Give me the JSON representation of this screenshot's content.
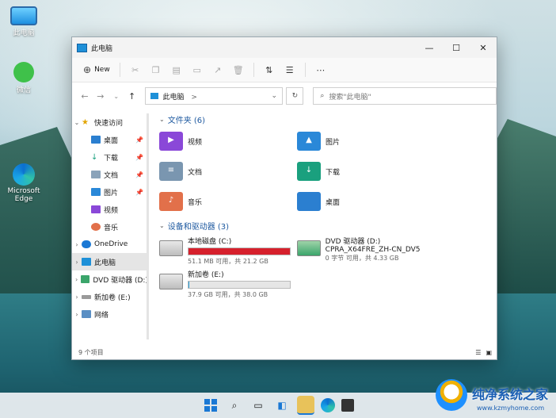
{
  "desktop": {
    "icons": [
      {
        "label": "此电脑",
        "icon": "computer-icon"
      },
      {
        "label": "微信",
        "icon": "wechat-icon"
      },
      {
        "label": "Microsoft Edge",
        "icon": "edge-icon"
      }
    ]
  },
  "window": {
    "title": "此电脑",
    "controls": {
      "minimize": "—",
      "maximize": "☐",
      "close": "✕"
    }
  },
  "toolbar": {
    "new_label": "New",
    "more_label": "⋯"
  },
  "address": {
    "path": "此电脑",
    "path_sep": ">",
    "search_placeholder": "搜索\"此电脑\""
  },
  "sidebar": {
    "items": [
      {
        "label": "快速访问",
        "level": 0,
        "expanded": true
      },
      {
        "label": "桌面",
        "level": 1,
        "pinned": true
      },
      {
        "label": "下载",
        "level": 1,
        "pinned": true
      },
      {
        "label": "文档",
        "level": 1,
        "pinned": true
      },
      {
        "label": "图片",
        "level": 1,
        "pinned": true
      },
      {
        "label": "视频",
        "level": 1,
        "pinned": false
      },
      {
        "label": "音乐",
        "level": 1,
        "pinned": false
      },
      {
        "label": "OneDrive",
        "level": 0
      },
      {
        "label": "此电脑",
        "level": 0,
        "selected": true
      },
      {
        "label": "DVD 驱动器 (D:)",
        "level": 0
      },
      {
        "label": "新加卷 (E:)",
        "level": 0
      },
      {
        "label": "网络",
        "level": 0
      }
    ]
  },
  "content": {
    "folders_header": "文件夹 (6)",
    "folders": [
      {
        "label": "视频",
        "color": "#8a48d8"
      },
      {
        "label": "图片",
        "color": "#2a88d8"
      },
      {
        "label": "文档",
        "color": "#7a96b0"
      },
      {
        "label": "下载",
        "color": "#1aa07e"
      },
      {
        "label": "音乐",
        "color": "#e2704a"
      },
      {
        "label": "桌面",
        "color": "#2b7fd0"
      }
    ],
    "drives_header": "设备和驱动器 (3)",
    "drives": [
      {
        "name": "本地磁盘 (C:)",
        "detail": "51.1 MB 可用，共 21.2 GB",
        "used_fraction": 0.998,
        "bar_color": "#d6202c",
        "has_bar": true
      },
      {
        "name": "DVD 驱动器 (D:)",
        "name2": "CPRA_X64FRE_ZH-CN_DV5",
        "detail": "0 字节 可用，共 4.33 GB",
        "has_bar": false
      },
      {
        "name": "新加卷 (E:)",
        "detail": "37.9 GB 可用，共 38.0 GB",
        "used_fraction": 0.003,
        "bar_color": "#26a0da",
        "has_bar": true
      }
    ]
  },
  "status": {
    "count": "9 个项目"
  },
  "watermark": {
    "title": "纯净系统之家",
    "url": "www.kzmyhome.com"
  }
}
